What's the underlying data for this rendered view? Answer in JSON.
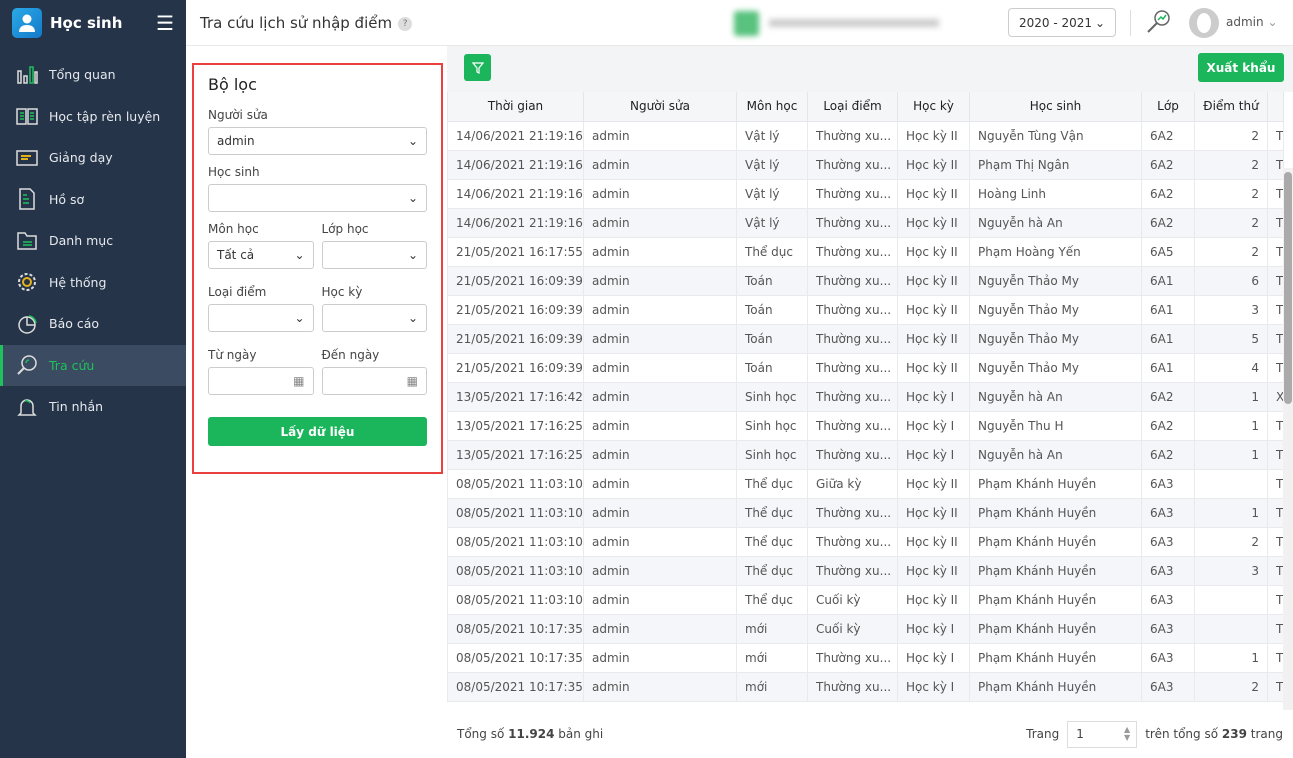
{
  "app": {
    "name": "Học sinh"
  },
  "sidebar": {
    "items": [
      {
        "label": "Tổng quan",
        "icon": "bar-chart-icon"
      },
      {
        "label": "Học tập rèn luyện",
        "icon": "book-icon"
      },
      {
        "label": "Giảng dạy",
        "icon": "board-icon"
      },
      {
        "label": "Hồ sơ",
        "icon": "document-icon"
      },
      {
        "label": "Danh mục",
        "icon": "folder-icon"
      },
      {
        "label": "Hệ thống",
        "icon": "gear-icon"
      },
      {
        "label": "Báo cáo",
        "icon": "pie-icon"
      },
      {
        "label": "Tra cứu",
        "icon": "search-icon",
        "active": true
      },
      {
        "label": "Tin nhắn",
        "icon": "bell-icon"
      }
    ]
  },
  "header": {
    "title": "Tra cứu lịch sử nhập điểm",
    "help": "?",
    "year": "2020 - 2021",
    "user": "admin"
  },
  "filter": {
    "title": "Bộ lọc",
    "editor_label": "Người sửa",
    "editor_value": "admin",
    "student_label": "Học sinh",
    "student_value": "",
    "subject_label": "Môn học",
    "subject_value": "Tất cả",
    "class_label": "Lớp học",
    "class_value": "",
    "type_label": "Loại điểm",
    "type_value": "",
    "term_label": "Học kỳ",
    "term_value": "",
    "from_label": "Từ ngày",
    "to_label": "Đến ngày",
    "submit": "Lấy dữ liệu"
  },
  "toolbar": {
    "export": "Xuất khẩu"
  },
  "table": {
    "columns": [
      "Thời gian",
      "Người sửa",
      "Môn học",
      "Loại điểm",
      "Học kỳ",
      "Học sinh",
      "Lớp",
      "Điểm thứ",
      ""
    ],
    "rows": [
      [
        "14/06/2021 21:19:16",
        "admin",
        "Vật lý",
        "Thường xu...",
        "Học kỳ II",
        "Nguyễn Tùng Vận",
        "6A2",
        "2",
        "Th"
      ],
      [
        "14/06/2021 21:19:16",
        "admin",
        "Vật lý",
        "Thường xu...",
        "Học kỳ II",
        "Phạm Thị Ngân",
        "6A2",
        "2",
        "Th"
      ],
      [
        "14/06/2021 21:19:16",
        "admin",
        "Vật lý",
        "Thường xu...",
        "Học kỳ II",
        "Hoàng Linh",
        "6A2",
        "2",
        "Th"
      ],
      [
        "14/06/2021 21:19:16",
        "admin",
        "Vật lý",
        "Thường xu...",
        "Học kỳ II",
        "Nguyễn hà An",
        "6A2",
        "2",
        "Th"
      ],
      [
        "21/05/2021 16:17:55",
        "admin",
        "Thể dục",
        "Thường xu...",
        "Học kỳ II",
        "Phạm Hoàng Yến",
        "6A5",
        "2",
        "Th"
      ],
      [
        "21/05/2021 16:09:39",
        "admin",
        "Toán",
        "Thường xu...",
        "Học kỳ II",
        "Nguyễn Thảo My",
        "6A1",
        "6",
        "Th"
      ],
      [
        "21/05/2021 16:09:39",
        "admin",
        "Toán",
        "Thường xu...",
        "Học kỳ II",
        "Nguyễn Thảo My",
        "6A1",
        "3",
        "Th"
      ],
      [
        "21/05/2021 16:09:39",
        "admin",
        "Toán",
        "Thường xu...",
        "Học kỳ II",
        "Nguyễn Thảo My",
        "6A1",
        "5",
        "Th"
      ],
      [
        "21/05/2021 16:09:39",
        "admin",
        "Toán",
        "Thường xu...",
        "Học kỳ II",
        "Nguyễn Thảo My",
        "6A1",
        "4",
        "Th"
      ],
      [
        "13/05/2021 17:16:42",
        "admin",
        "Sinh học",
        "Thường xu...",
        "Học kỳ I",
        "Nguyễn hà An",
        "6A2",
        "1",
        "X"
      ],
      [
        "13/05/2021 17:16:25",
        "admin",
        "Sinh học",
        "Thường xu...",
        "Học kỳ I",
        "Nguyễn Thu H",
        "6A2",
        "1",
        "Th"
      ],
      [
        "13/05/2021 17:16:25",
        "admin",
        "Sinh học",
        "Thường xu...",
        "Học kỳ I",
        "Nguyễn hà An",
        "6A2",
        "1",
        "Th"
      ],
      [
        "08/05/2021 11:03:10",
        "admin",
        "Thể dục",
        "Giữa kỳ",
        "Học kỳ II",
        "Phạm Khánh Huyền",
        "6A3",
        "",
        "Th"
      ],
      [
        "08/05/2021 11:03:10",
        "admin",
        "Thể dục",
        "Thường xu...",
        "Học kỳ II",
        "Phạm Khánh Huyền",
        "6A3",
        "1",
        "Th"
      ],
      [
        "08/05/2021 11:03:10",
        "admin",
        "Thể dục",
        "Thường xu...",
        "Học kỳ II",
        "Phạm Khánh Huyền",
        "6A3",
        "2",
        "Th"
      ],
      [
        "08/05/2021 11:03:10",
        "admin",
        "Thể dục",
        "Thường xu...",
        "Học kỳ II",
        "Phạm Khánh Huyền",
        "6A3",
        "3",
        "Th"
      ],
      [
        "08/05/2021 11:03:10",
        "admin",
        "Thể dục",
        "Cuối kỳ",
        "Học kỳ II",
        "Phạm Khánh Huyền",
        "6A3",
        "",
        "Th"
      ],
      [
        "08/05/2021 10:17:35",
        "admin",
        "mới",
        "Cuối kỳ",
        "Học kỳ I",
        "Phạm Khánh Huyền",
        "6A3",
        "",
        "Th"
      ],
      [
        "08/05/2021 10:17:35",
        "admin",
        "mới",
        "Thường xu...",
        "Học kỳ I",
        "Phạm Khánh Huyền",
        "6A3",
        "1",
        "Th"
      ],
      [
        "08/05/2021 10:17:35",
        "admin",
        "mới",
        "Thường xu...",
        "Học kỳ I",
        "Phạm Khánh Huyền",
        "6A3",
        "2",
        "Th"
      ]
    ]
  },
  "footer": {
    "total_prefix": "Tổng số",
    "total": "11.924",
    "total_suffix": "bản ghi",
    "page_label": "Trang",
    "page": "1",
    "pages_prefix": "trên tổng số",
    "pages": "239",
    "pages_suffix": "trang"
  }
}
